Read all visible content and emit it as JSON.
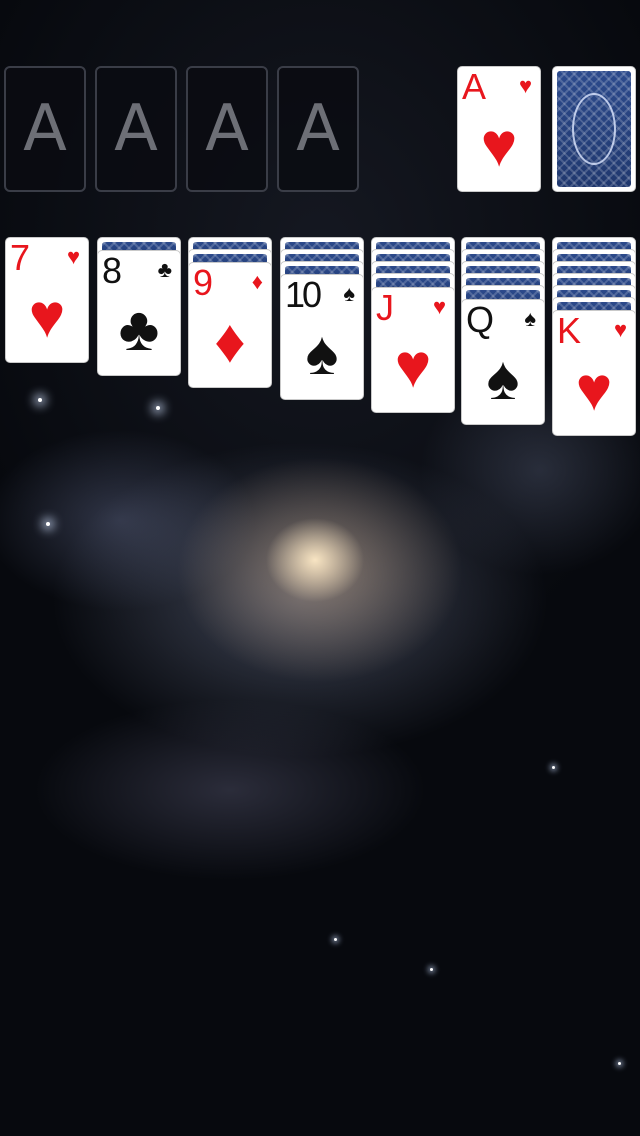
{
  "game": "Solitaire",
  "background": "galaxy",
  "foundations": [
    {
      "label": "A"
    },
    {
      "label": "A"
    },
    {
      "label": "A"
    },
    {
      "label": "A"
    }
  ],
  "waste": {
    "rank": "A",
    "suit": "hearts",
    "suit_glyph": "♥",
    "color": "red"
  },
  "stock": {
    "face_down": true
  },
  "tableau": [
    {
      "hidden": 0,
      "top": {
        "rank": "7",
        "suit": "hearts",
        "suit_glyph": "♥",
        "color": "red"
      }
    },
    {
      "hidden": 1,
      "top": {
        "rank": "8",
        "suit": "clubs",
        "suit_glyph": "♣",
        "color": "black"
      }
    },
    {
      "hidden": 2,
      "top": {
        "rank": "9",
        "suit": "diamonds",
        "suit_glyph": "♦",
        "color": "red"
      }
    },
    {
      "hidden": 3,
      "top": {
        "rank": "10",
        "suit": "spades",
        "suit_glyph": "♠",
        "color": "black"
      }
    },
    {
      "hidden": 4,
      "top": {
        "rank": "J",
        "suit": "hearts",
        "suit_glyph": "♥",
        "color": "red"
      }
    },
    {
      "hidden": 5,
      "top": {
        "rank": "Q",
        "suit": "spades",
        "suit_glyph": "♠",
        "color": "black"
      }
    },
    {
      "hidden": 6,
      "top": {
        "rank": "K",
        "suit": "hearts",
        "suit_glyph": "♥",
        "color": "red"
      }
    }
  ],
  "colors": {
    "red_suit": "#e8161d",
    "black_suit": "#111111",
    "card_back": "#2c4a8c"
  }
}
